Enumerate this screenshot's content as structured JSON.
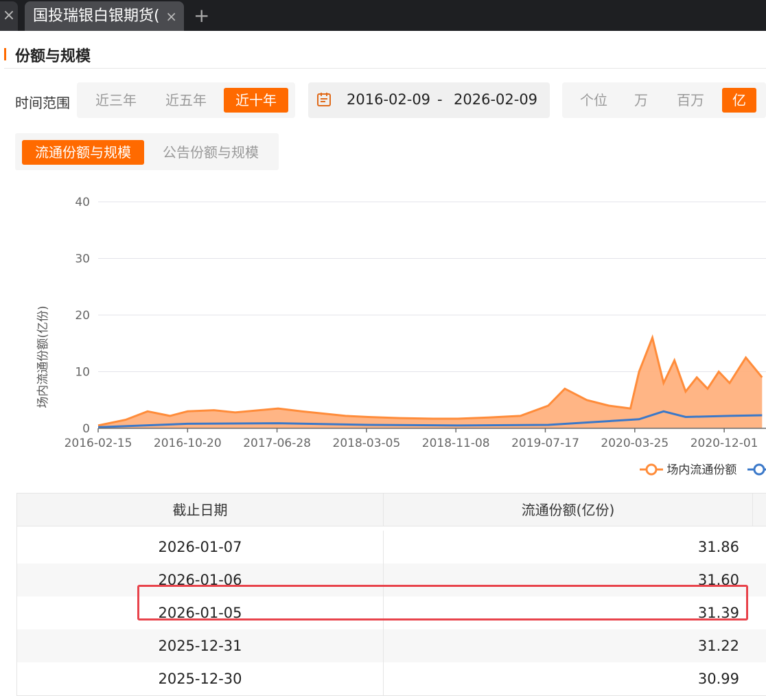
{
  "browser": {
    "tab_title": "国投瑞银白银期货(",
    "tab_close": "×",
    "new_tab": "+",
    "left_tab_close": "×"
  },
  "section": {
    "title": "份额与规模"
  },
  "filters": {
    "range_label": "时间范围",
    "ranges": [
      "近三年",
      "近五年",
      "近十年"
    ],
    "active_range": "近十年",
    "date_start": "2016-02-09",
    "date_sep": "-",
    "date_end": "2026-02-09",
    "units": [
      "个位",
      "万",
      "百万",
      "亿"
    ],
    "active_unit": "亿"
  },
  "subtabs": {
    "items": [
      "流通份额与规模",
      "公告份额与规模"
    ],
    "active": "流通份额与规模"
  },
  "chart_data": {
    "type": "area",
    "ylabel": "场内流通份额(亿份)",
    "ylim": [
      0,
      40
    ],
    "yticks": [
      "0",
      "10",
      "20",
      "30",
      "40"
    ],
    "x_tick_labels": [
      "2016-02-15",
      "2016-10-20",
      "2017-06-28",
      "2018-03-05",
      "2018-11-08",
      "2019-07-17",
      "2020-03-25",
      "2020-12-01"
    ],
    "series": [
      {
        "name": "场内流通份额",
        "color": "#ff8c3a",
        "x": [
          "2016-02-15",
          "2016-05-01",
          "2016-07-01",
          "2016-09-01",
          "2016-10-20",
          "2017-01-01",
          "2017-03-01",
          "2017-06-28",
          "2017-09-01",
          "2018-01-01",
          "2018-03-05",
          "2018-06-01",
          "2018-09-01",
          "2018-11-08",
          "2019-02-01",
          "2019-05-01",
          "2019-07-17",
          "2019-09-01",
          "2019-11-01",
          "2020-01-01",
          "2020-03-01",
          "2020-03-25",
          "2020-05-01",
          "2020-06-01",
          "2020-07-01",
          "2020-08-01",
          "2020-09-01",
          "2020-10-01",
          "2020-11-01",
          "2020-12-01",
          "2021-01-15",
          "2021-03-01"
        ],
        "values": [
          0.5,
          1.5,
          3.0,
          2.2,
          3.0,
          3.2,
          2.8,
          3.5,
          3.0,
          2.2,
          2.0,
          1.8,
          1.7,
          1.7,
          1.9,
          2.2,
          4.0,
          7.0,
          5.0,
          4.0,
          3.5,
          10.0,
          16.0,
          8.0,
          12.0,
          6.5,
          9.0,
          7.0,
          10.0,
          8.0,
          12.5,
          9.0
        ]
      },
      {
        "name": "",
        "color": "#3a78c9",
        "x": [
          "2016-02-15",
          "2016-10-20",
          "2017-06-28",
          "2018-03-05",
          "2018-11-08",
          "2019-07-17",
          "2020-03-25",
          "2020-06-01",
          "2020-08-01",
          "2020-12-01",
          "2021-03-01"
        ],
        "values": [
          0.2,
          0.8,
          0.9,
          0.6,
          0.5,
          0.6,
          1.6,
          3.0,
          2.0,
          2.2,
          2.3
        ]
      }
    ],
    "grid": true,
    "legend_position": "bottom-right"
  },
  "table": {
    "headers": [
      "截止日期",
      "流通份额(亿份)"
    ],
    "rows": [
      {
        "date": "2026-01-07",
        "value": "31.86"
      },
      {
        "date": "2026-01-06",
        "value": "31.60"
      },
      {
        "date": "2026-01-05",
        "value": "31.39"
      },
      {
        "date": "2025-12-31",
        "value": "31.22"
      },
      {
        "date": "2025-12-30",
        "value": "30.99"
      }
    ],
    "highlighted_row": "2025-12-31",
    "highlight_color": "#e8434b"
  },
  "accent_color": "#ff6a00"
}
